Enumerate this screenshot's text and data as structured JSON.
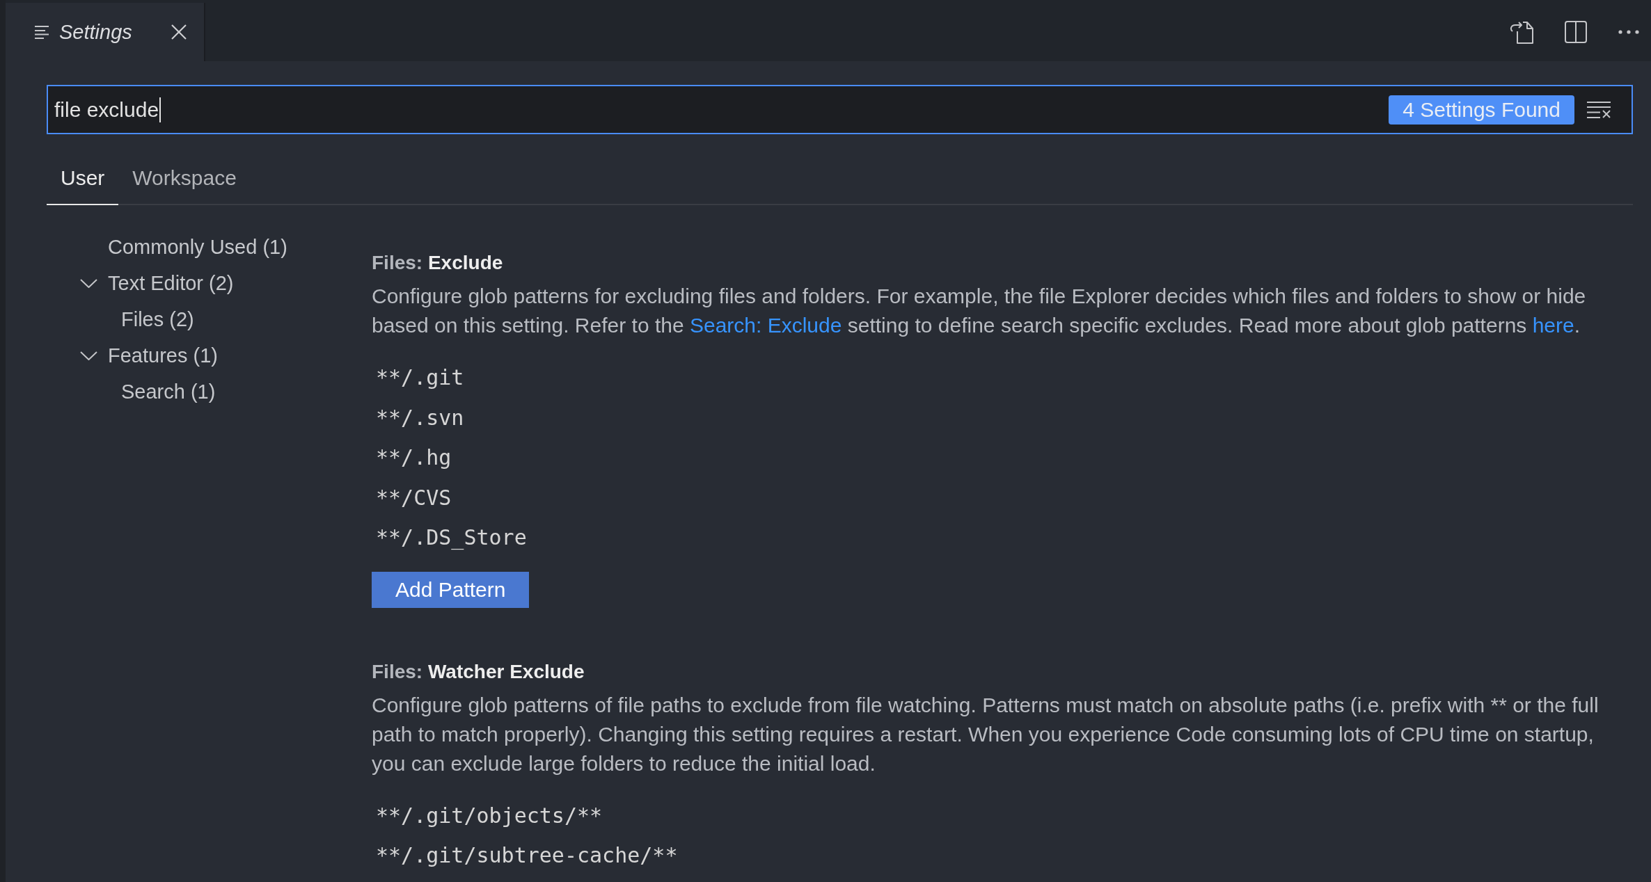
{
  "editor_tab": {
    "title": "Settings"
  },
  "search": {
    "value": "file exclude",
    "badge": "4 Settings Found"
  },
  "scope_tabs": [
    {
      "label": "User",
      "selected": true
    },
    {
      "label": "Workspace",
      "selected": false
    }
  ],
  "toc": [
    {
      "label": "Commonly Used (1)"
    },
    {
      "label": "Text Editor (2)",
      "expanded": true,
      "children": [
        {
          "label": "Files (2)"
        }
      ]
    },
    {
      "label": "Features (1)",
      "expanded": true,
      "children": [
        {
          "label": "Search (1)"
        }
      ]
    }
  ],
  "settings": [
    {
      "title": "Files: **Exclude**",
      "description": [
        {
          "kind": "text",
          "text": "Configure glob patterns for excluding files and folders. For example, the file Explorer decides which files and folders to show or hide based on this setting. Refer to the "
        },
        {
          "kind": "link",
          "text": "Search: Exclude"
        },
        {
          "kind": "text",
          "text": " setting to define search specific excludes. Read more about glob patterns "
        },
        {
          "kind": "link",
          "text": "here"
        },
        {
          "kind": "text",
          "text": "."
        }
      ],
      "patterns": [
        "**/.git",
        "**/.svn",
        "**/.hg",
        "**/CVS",
        "**/.DS_Store"
      ],
      "button": "Add Pattern"
    },
    {
      "title": "Files: **Watcher Exclude**",
      "description": [
        {
          "kind": "text",
          "text": "Configure glob patterns of file paths to exclude from file watching. Patterns must match on absolute paths (i.e. prefix with ** or the full path to match properly). Changing this setting requires a restart. When you experience Code consuming lots of CPU time on startup, you can exclude large folders to reduce the initial load."
        }
      ],
      "patterns": [
        "**/.git/objects/**",
        "**/.git/subtree-cache/**"
      ]
    }
  ]
}
